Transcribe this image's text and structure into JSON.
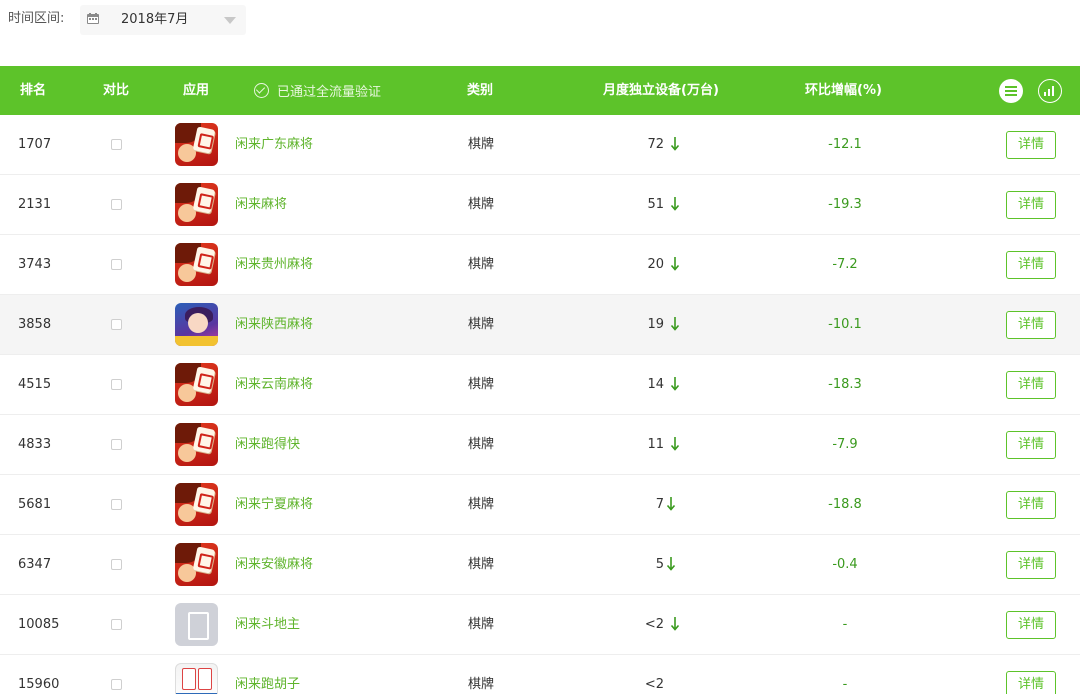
{
  "filter": {
    "label": "时间区间:",
    "date_value": "2018年7月",
    "calendar_icon": "calendar-icon",
    "dropdown_icon": "caret-down-icon"
  },
  "table": {
    "headers": {
      "rank": "排名",
      "compare": "对比",
      "app": "应用",
      "verified": "已通过全流量验证",
      "category": "类别",
      "devices": "月度独立设备(万台)",
      "growth": "环比增幅(%)"
    },
    "header_icons": [
      "check-circle-icon",
      "list-view-icon",
      "chart-view-icon"
    ],
    "rows": [
      {
        "rank": "1707",
        "app": "闲来广东麻将",
        "category": "棋牌",
        "devices": "72",
        "trend": "down",
        "growth": "-12.1",
        "detail": "详情",
        "icon": "mahjong"
      },
      {
        "rank": "2131",
        "app": "闲来麻将",
        "category": "棋牌",
        "devices": "51",
        "trend": "down",
        "growth": "-19.3",
        "detail": "详情",
        "icon": "mahjong"
      },
      {
        "rank": "3743",
        "app": "闲来贵州麻将",
        "category": "棋牌",
        "devices": "20",
        "trend": "down",
        "growth": "-7.2",
        "detail": "详情",
        "icon": "mahjong"
      },
      {
        "rank": "3858",
        "app": "闲来陕西麻将",
        "category": "棋牌",
        "devices": "19",
        "trend": "down",
        "growth": "-10.1",
        "detail": "详情",
        "icon": "shaanxi"
      },
      {
        "rank": "4515",
        "app": "闲来云南麻将",
        "category": "棋牌",
        "devices": "14",
        "trend": "down",
        "growth": "-18.3",
        "detail": "详情",
        "icon": "mahjong"
      },
      {
        "rank": "4833",
        "app": "闲来跑得快",
        "category": "棋牌",
        "devices": "11",
        "trend": "down",
        "growth": "-7.9",
        "detail": "详情",
        "icon": "mahjong"
      },
      {
        "rank": "5681",
        "app": "闲来宁夏麻将",
        "category": "棋牌",
        "devices": "7",
        "trend": "down",
        "growth": "-18.8",
        "detail": "详情",
        "icon": "mahjong"
      },
      {
        "rank": "6347",
        "app": "闲来安徽麻将",
        "category": "棋牌",
        "devices": "5",
        "trend": "down",
        "growth": "-0.4",
        "detail": "详情",
        "icon": "mahjong"
      },
      {
        "rank": "10085",
        "app": "闲来斗地主",
        "category": "棋牌",
        "devices": "<2",
        "trend": "down",
        "growth": "-",
        "detail": "详情",
        "icon": "placeholder"
      },
      {
        "rank": "15960",
        "app": "闲来跑胡子",
        "category": "棋牌",
        "devices": "<2",
        "trend": "none",
        "growth": "-",
        "detail": "详情",
        "icon": "hu"
      }
    ]
  },
  "colors": {
    "header_bg": "#5dc32a",
    "link": "#5fb42c",
    "growth": "#3a9a1e"
  }
}
